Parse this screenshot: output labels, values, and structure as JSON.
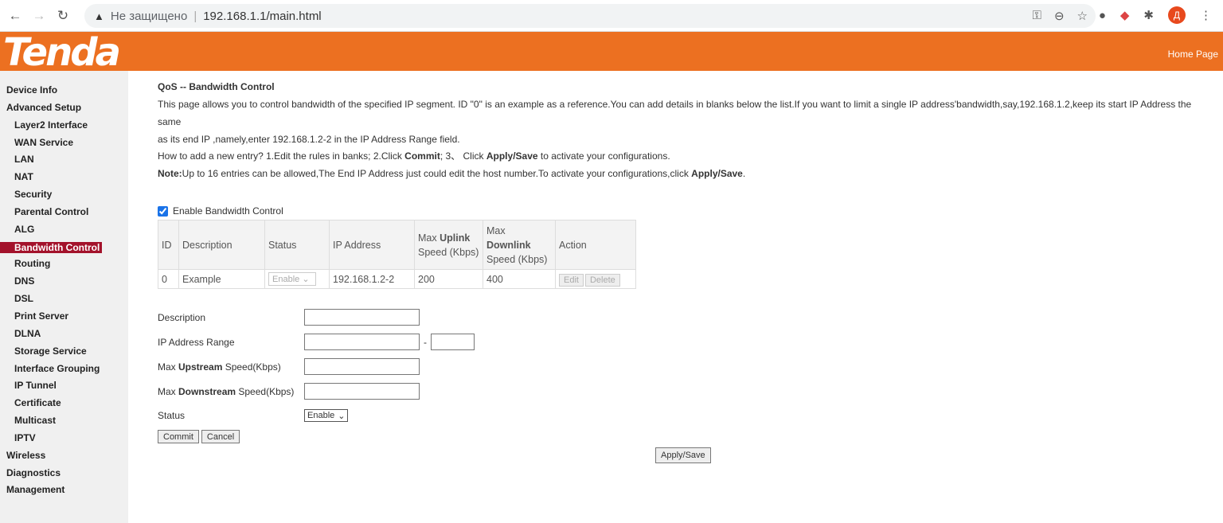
{
  "browser": {
    "security_label": "Не защищено",
    "url": "192.168.1.1/main.html",
    "profile_initial": "Д"
  },
  "header": {
    "logo": "Tenda",
    "home_link": "Home Page",
    "brand_color": "#ec7021"
  },
  "sidebar": {
    "items": [
      {
        "label": "Device Info",
        "level": 0
      },
      {
        "label": "Advanced Setup",
        "level": 0
      },
      {
        "label": "Layer2 Interface",
        "level": 1
      },
      {
        "label": "WAN Service",
        "level": 1
      },
      {
        "label": "LAN",
        "level": 1
      },
      {
        "label": "NAT",
        "level": 1
      },
      {
        "label": "Security",
        "level": 1
      },
      {
        "label": "Parental Control",
        "level": 1
      },
      {
        "label": "ALG",
        "level": 1
      },
      {
        "label": "Bandwidth Control",
        "level": 1,
        "selected": true
      },
      {
        "label": "Routing",
        "level": 1
      },
      {
        "label": "DNS",
        "level": 1
      },
      {
        "label": "DSL",
        "level": 1
      },
      {
        "label": "Print Server",
        "level": 1
      },
      {
        "label": "DLNA",
        "level": 1
      },
      {
        "label": "Storage Service",
        "level": 1
      },
      {
        "label": "Interface Grouping",
        "level": 1
      },
      {
        "label": "IP Tunnel",
        "level": 1
      },
      {
        "label": "Certificate",
        "level": 1
      },
      {
        "label": "Multicast",
        "level": 1
      },
      {
        "label": "IPTV",
        "level": 1
      },
      {
        "label": "Wireless",
        "level": 0
      },
      {
        "label": "Diagnostics",
        "level": 0
      },
      {
        "label": "Management",
        "level": 0
      }
    ]
  },
  "main": {
    "title": "QoS -- Bandwidth Control",
    "intro1": "This page allows you to control bandwidth of the specified IP segment. ID \"0\" is an example as a reference.You can add details in blanks below the list.If you want to limit a single IP address'bandwidth,say,192.168.1.2,keep its start IP Address the same",
    "intro2": "as its end IP ,namely,enter 192.168.1.2-2 in the IP Address Range field.",
    "howto": {
      "a": "How to add a new entry? 1.Edit the rules in banks; 2.Click ",
      "b": "Commit",
      "c": "; 3、 Click ",
      "d": "Apply/Save",
      "e": " to activate your configurations."
    },
    "note": {
      "a": "Note:",
      "b": "Up to 16 entries can be allowed,The End IP Address just could edit the host number.To activate your configurations,click ",
      "c": "Apply/Save",
      "d": "."
    },
    "enable_label": "Enable Bandwidth Control",
    "enable_checked": true,
    "table": {
      "headers": {
        "id": "ID",
        "desc": "Description",
        "status": "Status",
        "ip": "IP Address",
        "up_a": "Max ",
        "up_b": "Uplink",
        "up_c": "Speed (Kbps)",
        "down_a": "Max",
        "down_b": "Downlink",
        "down_c": "Speed (Kbps)",
        "action": "Action"
      },
      "rows": [
        {
          "id": "0",
          "desc": "Example",
          "status": "Enable",
          "ip": "192.168.1.2-2",
          "up": "200",
          "down": "400",
          "edit": "Edit",
          "delete": "Delete"
        }
      ]
    },
    "form": {
      "description": "Description",
      "ip_range": "IP Address Range",
      "dash": "-",
      "up_a": "Max ",
      "up_b": "Upstream",
      "up_c": " Speed(Kbps)",
      "down_a": "Max ",
      "down_b": "Downstream",
      "down_c": " Speed(Kbps)",
      "status": "Status",
      "status_value": "Enable",
      "commit": "Commit",
      "cancel": "Cancel",
      "apply": "Apply/Save"
    }
  }
}
